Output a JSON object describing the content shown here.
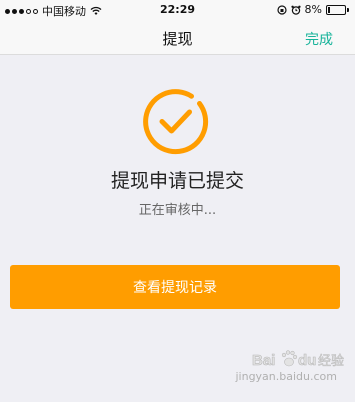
{
  "status_bar": {
    "carrier": "中国移动",
    "time": "22:29",
    "battery": "8%",
    "battery_level": 0.08
  },
  "nav": {
    "title": "提现",
    "done_label": "完成"
  },
  "result": {
    "title": "提现申请已提交",
    "subtitle": "正在审核中..."
  },
  "actions": {
    "view_records_label": "查看提现记录"
  },
  "watermark": {
    "logo_text": "Baidu经验",
    "url": "jingyan.baidu.com"
  },
  "colors": {
    "accent_orange": "#ff9d00",
    "done_green": "#17b39a",
    "background": "#efeff4"
  }
}
